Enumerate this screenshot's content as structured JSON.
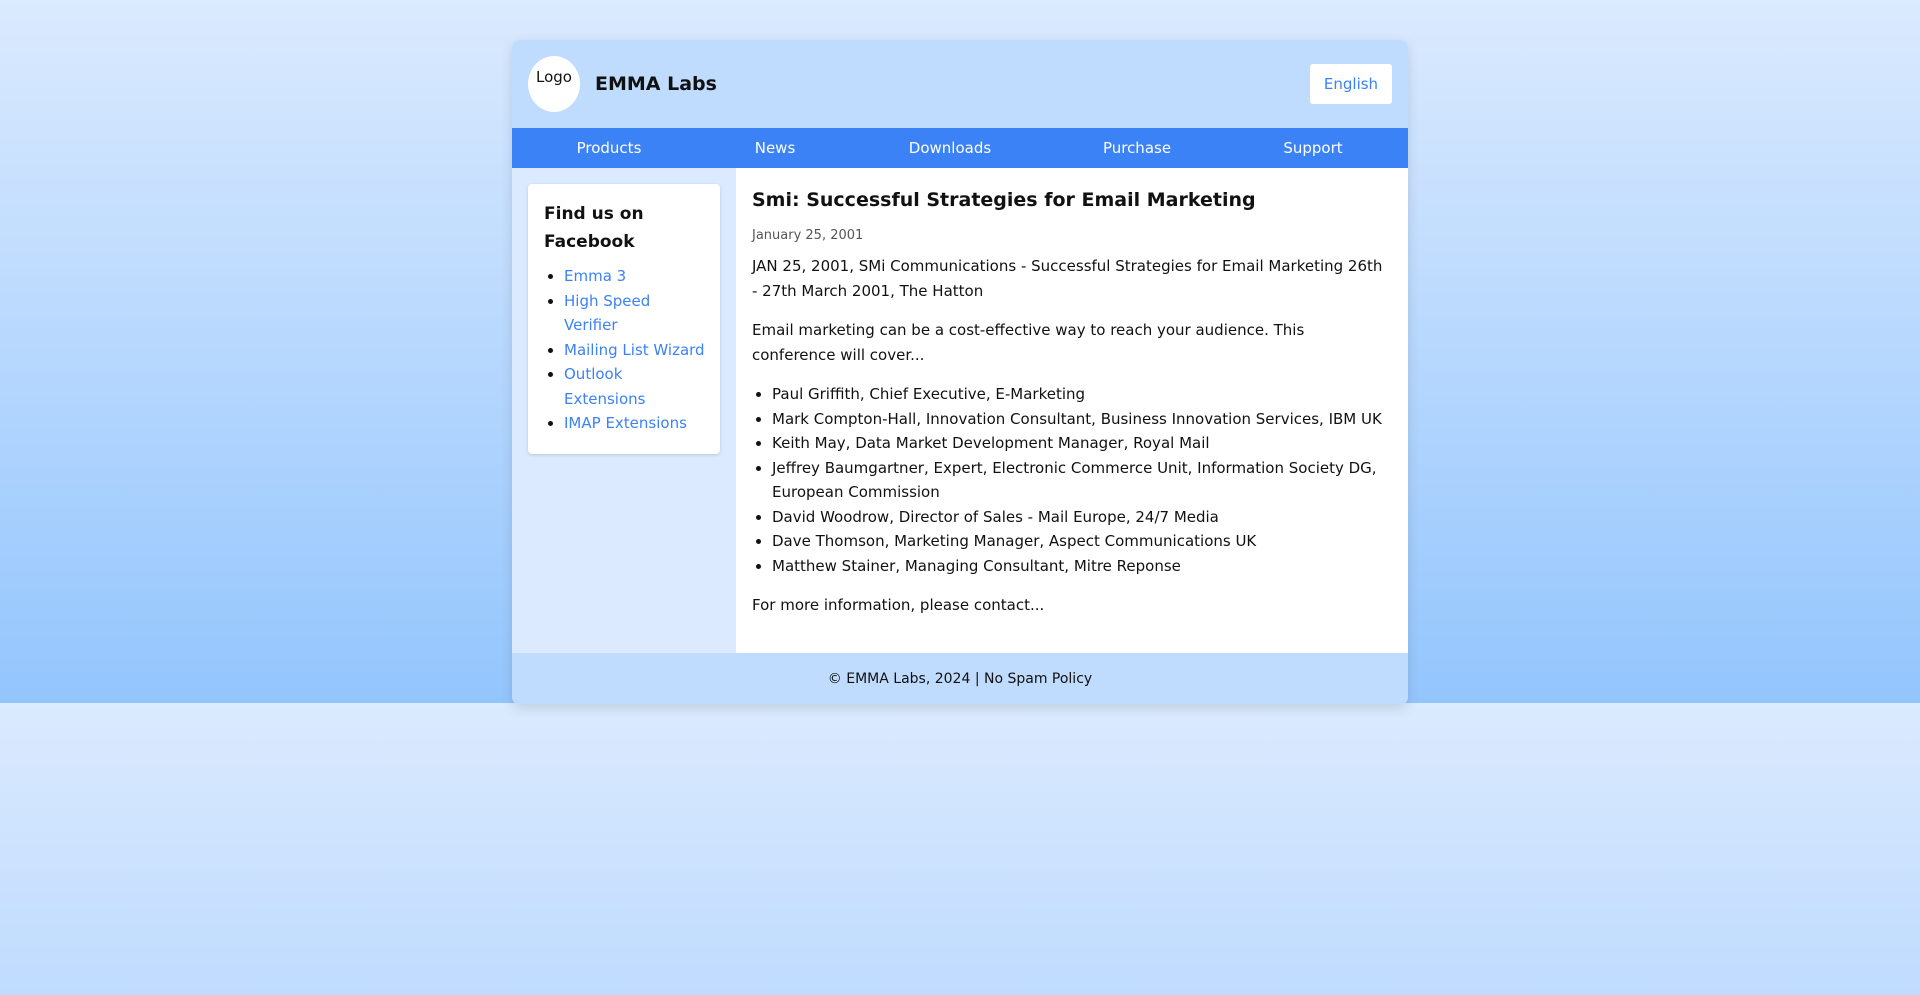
{
  "header": {
    "logo_text": "Logo",
    "brand": "EMMA Labs",
    "language": "English"
  },
  "nav": {
    "items": [
      {
        "label": "Products"
      },
      {
        "label": "News"
      },
      {
        "label": "Downloads"
      },
      {
        "label": "Purchase"
      },
      {
        "label": "Support"
      }
    ]
  },
  "sidebar": {
    "title": "Find us on Facebook",
    "links": [
      {
        "label": "Emma 3"
      },
      {
        "label": "High Speed Verifier"
      },
      {
        "label": "Mailing List Wizard"
      },
      {
        "label": "Outlook Extensions"
      },
      {
        "label": "IMAP Extensions"
      }
    ]
  },
  "article": {
    "title": "Smi: Successful Strategies for Email Marketing",
    "date": "January 25, 2001",
    "intro": "JAN 25, 2001, SMi Communications - Successful Strategies for Email Marketing 26th - 27th March 2001, The Hatton",
    "summary": "Email marketing can be a cost-effective way to reach your audience. This conference will cover...",
    "speakers": [
      "Paul Griffith, Chief Executive, E-Marketing",
      "Mark Compton-Hall, Innovation Consultant, Business Innovation Services, IBM UK",
      "Keith May, Data Market Development Manager, Royal Mail",
      "Jeffrey Baumgartner, Expert, Electronic Commerce Unit, Information Society DG, European Commission",
      "David Woodrow, Director of Sales - Mail Europe, 24/7 Media",
      "Dave Thomson, Marketing Manager, Aspect Communications UK",
      "Matthew Stainer, Managing Consultant, Mitre Reponse"
    ],
    "closing": "For more information, please contact..."
  },
  "footer": {
    "text": "© EMMA Labs, 2024 | No Spam Policy"
  }
}
